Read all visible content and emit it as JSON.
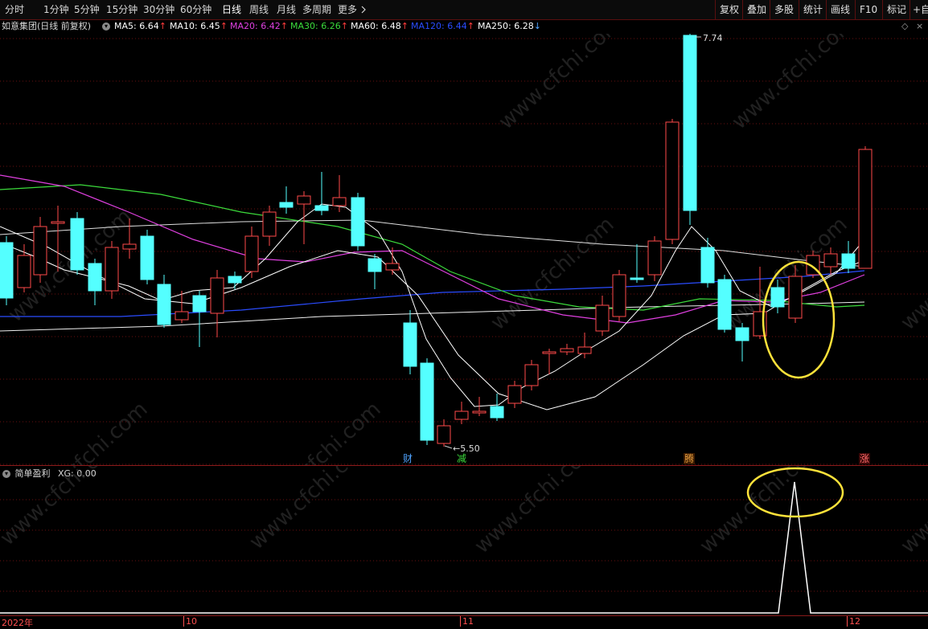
{
  "toolbar": {
    "periods": [
      {
        "label": "分时",
        "active": false
      },
      {
        "label": "1分钟",
        "active": false
      },
      {
        "label": "5分钟",
        "active": false
      },
      {
        "label": "15分钟",
        "active": false
      },
      {
        "label": "30分钟",
        "active": false
      },
      {
        "label": "60分钟",
        "active": false
      },
      {
        "label": "日线",
        "active": true
      },
      {
        "label": "周线",
        "active": false
      },
      {
        "label": "月线",
        "active": false
      },
      {
        "label": "多周期",
        "active": false
      },
      {
        "label": "更多",
        "active": false
      }
    ],
    "right_buttons": [
      "复权",
      "叠加",
      "多股",
      "统计",
      "画线",
      "F10",
      "标记",
      "+自"
    ]
  },
  "header": {
    "stock_title": "如意集团(日线 前复权)",
    "ma": [
      {
        "label": "MA5: 6.64",
        "color": "#ffffff",
        "dir": "up"
      },
      {
        "label": "MA10: 6.45",
        "color": "#ffffff",
        "dir": "up"
      },
      {
        "label": "MA20: 6.42",
        "color": "#e040e0",
        "dir": "up"
      },
      {
        "label": "MA30: 6.26",
        "color": "#3cdc3c",
        "dir": "up"
      },
      {
        "label": "MA60: 6.48",
        "color": "#ffffff",
        "dir": "up"
      },
      {
        "label": "MA120: 6.44",
        "color": "#2a4cff",
        "dir": "up"
      },
      {
        "label": "MA250: 6.28",
        "color": "#ffffff",
        "dir": "down"
      }
    ]
  },
  "annotations": {
    "high_label": "7.74",
    "low_label": "5.50",
    "markers": [
      {
        "text": "财",
        "color": "#4fa3ff"
      },
      {
        "text": "减",
        "color": "#3cdc3c"
      },
      {
        "text": "腾",
        "color": "#e8a040"
      },
      {
        "text": "涨",
        "color": "#ff6a6a"
      }
    ]
  },
  "indicator": {
    "name": "简单盈利",
    "value_label": "XG: 0.00"
  },
  "xaxis": {
    "labels": [
      "2022年",
      "10",
      "11",
      "12"
    ]
  },
  "watermark": "www.cfchi.com",
  "colors": {
    "up": "#ff4a4a",
    "down": "#54ffff",
    "circle": "#ffe23a",
    "grid": "#6a1010"
  }
}
